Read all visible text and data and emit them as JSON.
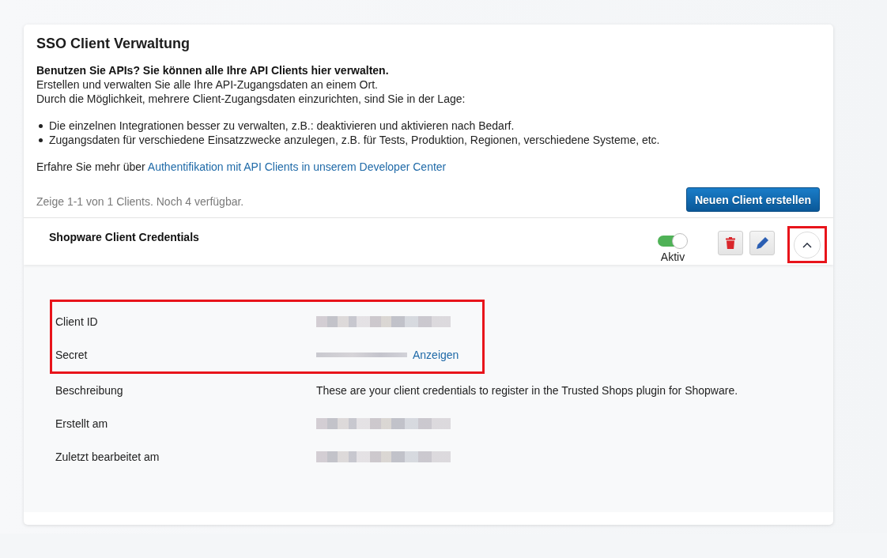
{
  "page": {
    "title": "SSO Client Verwaltung"
  },
  "intro": {
    "lead": "Benutzen Sie APIs? Sie können alle Ihre API Clients hier verwalten.",
    "lines": [
      "Erstellen und verwalten Sie alle Ihre API-Zugangsdaten an einem Ort.",
      "Durch die Möglichkeit, mehrere Client-Zugangsdaten einzurichten, sind Sie in der Lage:"
    ],
    "bullets": [
      "Die einzelnen Integrationen besser zu verwalten, z.B.: deaktivieren und aktivieren nach Bedarf.",
      "Zugangsdaten für verschiedene Einsatzzwecke anzulegen, z.B. für Tests, Produktion, Regionen, verschiedene Systeme, etc."
    ],
    "more": {
      "text": "Erfahre Sie mehr über",
      "link": "Authentifikation mit API Clients in unserem Developer Center"
    }
  },
  "summary": "Zeige 1-1 von 1 Clients. Noch 4 verfügbar.",
  "create_button": "Neuen Client erstellen",
  "clients": [
    {
      "name": "Shopware Client Credentials",
      "status": {
        "label": "Aktiv",
        "on": true
      },
      "actions": [
        {
          "kind": "delete"
        },
        {
          "kind": "edit"
        }
      ],
      "expanded": true,
      "expand_button": {
        "highlighted": true
      },
      "details": [
        {
          "label": "Client ID",
          "kind": "redacted",
          "highlighted": true
        },
        {
          "label": "Secret",
          "kind": "masked",
          "action": "Anzeigen",
          "highlighted": true
        },
        {
          "label": "Beschreibung",
          "kind": "text",
          "value": "These are your client credentials to register in the Trusted Shops plugin for Shopware.",
          "highlighted": false
        },
        {
          "label": "Erstellt am",
          "kind": "redacted",
          "highlighted": false
        },
        {
          "label": "Zuletzt bearbeitet am",
          "kind": "redacted",
          "highlighted": false
        }
      ]
    }
  ]
}
